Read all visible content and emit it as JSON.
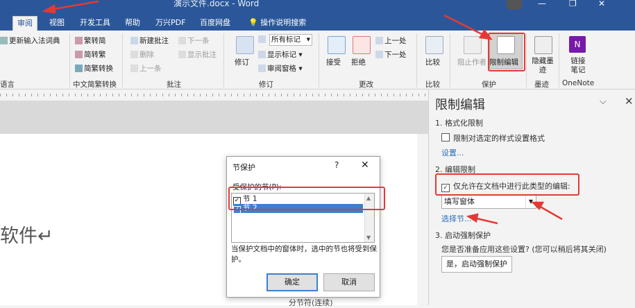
{
  "window": {
    "title": "演示文件.docx  -  Word"
  },
  "tabs": {
    "review": "审阅",
    "view": "视图",
    "developer": "开发工具",
    "help": "帮助",
    "wanxing_pdf": "万兴PDF",
    "baidu_disk": "百度网盘",
    "tell_me": "操作说明搜索"
  },
  "ribbon": {
    "update_ime_dict": "更新输入法词典",
    "language_group": "语言",
    "trad_to_simp": "繁转简",
    "simp_to_trad": "简转繁",
    "conversion": "简繁转换",
    "chinese_group": "中文简繁转换",
    "new_comment": "新建批注",
    "delete": "删除",
    "previous": "上一条",
    "next": "下一条",
    "show_comments": "显示批注",
    "comments_group": "批注",
    "track_changes": "修订",
    "all_markup": "所有标记",
    "show_markup": "显示标记",
    "reviewing_pane": "审阅窗格",
    "tracking_group": "修订",
    "accept": "接受",
    "reject": "拒绝",
    "prev_change": "上一处",
    "next_change": "下一处",
    "changes_group": "更改",
    "compare": "比较",
    "compare_group": "比较",
    "block_authors": "阻止作者",
    "restrict_editing": "限制编辑",
    "protect_group": "保护",
    "hide_ink": "隐藏墨迹",
    "ink_group": "墨迹",
    "linked_notes": "链接笔记",
    "onenote_group": "OneNote"
  },
  "document": {
    "visible_text": "软件↵",
    "bottom_text": "分节符(连续)"
  },
  "dialog": {
    "title": "节保护",
    "help": "?",
    "close": "✕",
    "list_label": "受保护的节(P):",
    "sections": [
      {
        "label": "节 1",
        "checked": true
      },
      {
        "label": "节 2",
        "checked": true
      }
    ],
    "note": "当保护文档中的窗体时，选中的节也将受到保护。",
    "ok": "确定",
    "cancel": "取消"
  },
  "pane": {
    "title": "限制编辑",
    "s1_heading": "1. 格式化限制",
    "s1_checkbox": "限制对选定的样式设置格式",
    "s1_checked": false,
    "s1_link": "设置...",
    "s2_heading": "2. 编辑限制",
    "s2_checkbox": "仅允许在文档中进行此类型的编辑:",
    "s2_checked": true,
    "s2_select": "填写窗体",
    "s2_link": "选择节...",
    "s3_heading": "3. 启动强制保护",
    "s3_question": "您是否准备应用这些设置? (您可以稍后将其关闭)",
    "s3_button": "是，启动强制保护"
  },
  "colors": {
    "accent": "#2b579a",
    "annotation": "#e53935",
    "selection": "#3c7fd0"
  }
}
